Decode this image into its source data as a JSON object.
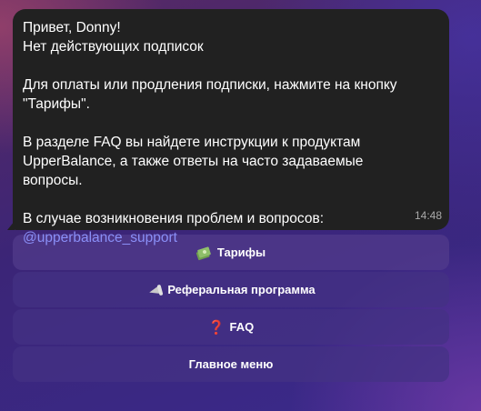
{
  "message": {
    "lines": [
      "Привет, Donny!",
      "Нет действующих подписок",
      "",
      "Для оплаты или продления подписки, нажмите на кнопку",
      "\"Тарифы\".",
      "",
      "В разделе FAQ вы найдете инструкции к продуктам",
      "UpperBalance, а также ответы на часто задаваемые",
      "вопросы.",
      "",
      "В случае возникновения проблем и вопросов:"
    ],
    "link": "@upperbalance_support",
    "time": "14:48"
  },
  "keyboard": {
    "buttons": [
      {
        "icon": "money-with-wings-icon",
        "label": "Тарифы"
      },
      {
        "icon": "megaphone-icon",
        "label": "Реферальная программа"
      },
      {
        "icon": "question-mark-icon",
        "glyph": "❓",
        "label": "FAQ"
      },
      {
        "label": "Главное меню"
      }
    ]
  },
  "colors": {
    "bubble": "#212121",
    "link": "#8a8ff7",
    "button": "#443284",
    "time": "#aaaaaa"
  }
}
